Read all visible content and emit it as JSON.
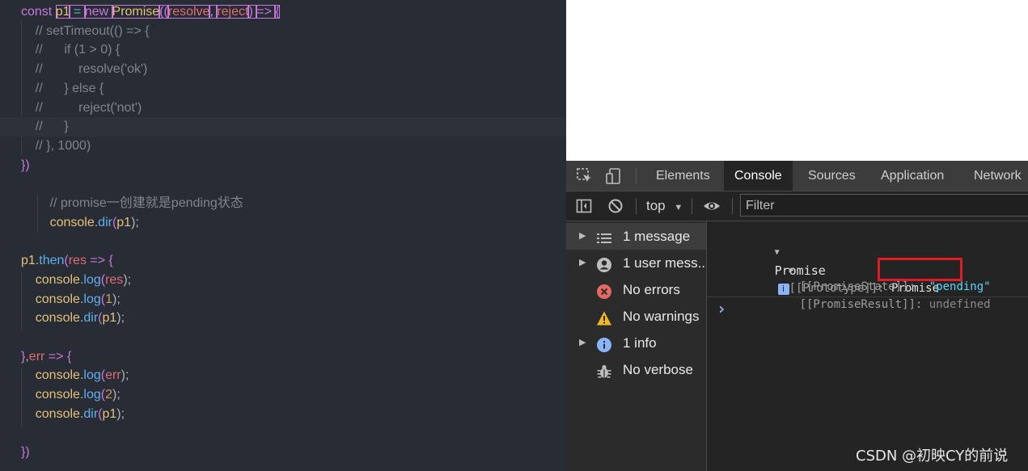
{
  "editor": {
    "lines": [
      {
        "tokens": [
          {
            "t": "const ",
            "c": "kw"
          },
          {
            "t": "p1",
            "c": "var"
          },
          {
            "t": " = ",
            "c": "op"
          },
          {
            "t": "new ",
            "c": "kw"
          },
          {
            "t": "Promise",
            "c": "cls"
          },
          {
            "t": "((",
            "c": "brk"
          },
          {
            "t": "resolve",
            "c": "par"
          },
          {
            "t": ", ",
            "c": "pl"
          },
          {
            "t": "reject",
            "c": "par"
          },
          {
            "t": ") ",
            "c": "brk"
          },
          {
            "t": "=> ",
            "c": "kw"
          },
          {
            "t": "{",
            "c": "brk"
          }
        ]
      },
      {
        "tokens": [
          {
            "t": "    // setTimeout(() => {",
            "c": "com"
          }
        ]
      },
      {
        "tokens": [
          {
            "t": "    //      if (1 > 0) {",
            "c": "com"
          }
        ]
      },
      {
        "tokens": [
          {
            "t": "    //          resolve('ok')",
            "c": "com"
          }
        ]
      },
      {
        "tokens": [
          {
            "t": "    //      } else {",
            "c": "com"
          }
        ]
      },
      {
        "tokens": [
          {
            "t": "    //          reject('not')",
            "c": "com"
          }
        ]
      },
      {
        "tokens": [
          {
            "t": "    //      }",
            "c": "com"
          }
        ]
      },
      {
        "tokens": [
          {
            "t": "    // }, 1000)",
            "c": "com"
          }
        ]
      },
      {
        "tokens": [
          {
            "t": "})",
            "c": "brk"
          }
        ]
      },
      {
        "tokens": []
      },
      {
        "tokens": [
          {
            "t": "        // promise一创建就是pending状态",
            "c": "com"
          }
        ]
      },
      {
        "tokens": [
          {
            "t": "        console",
            "c": "var"
          },
          {
            "t": ".",
            "c": "pl"
          },
          {
            "t": "dir",
            "c": "fn"
          },
          {
            "t": "(",
            "c": "brk"
          },
          {
            "t": "p1",
            "c": "var"
          },
          {
            "t": ");",
            "c": "pl"
          }
        ]
      },
      {
        "tokens": []
      },
      {
        "tokens": [
          {
            "t": "p1",
            "c": "var"
          },
          {
            "t": ".",
            "c": "pl"
          },
          {
            "t": "then",
            "c": "fn"
          },
          {
            "t": "(",
            "c": "brk"
          },
          {
            "t": "res",
            "c": "par"
          },
          {
            "t": " => ",
            "c": "kw"
          },
          {
            "t": "{",
            "c": "brk"
          }
        ]
      },
      {
        "tokens": [
          {
            "t": "    console",
            "c": "var"
          },
          {
            "t": ".",
            "c": "pl"
          },
          {
            "t": "log",
            "c": "fn"
          },
          {
            "t": "(",
            "c": "brk"
          },
          {
            "t": "res",
            "c": "par"
          },
          {
            "t": ");",
            "c": "pl"
          }
        ]
      },
      {
        "tokens": [
          {
            "t": "    console",
            "c": "var"
          },
          {
            "t": ".",
            "c": "pl"
          },
          {
            "t": "log",
            "c": "fn"
          },
          {
            "t": "(",
            "c": "brk"
          },
          {
            "t": "1",
            "c": "num"
          },
          {
            "t": ");",
            "c": "pl"
          }
        ]
      },
      {
        "tokens": [
          {
            "t": "    console",
            "c": "var"
          },
          {
            "t": ".",
            "c": "pl"
          },
          {
            "t": "dir",
            "c": "fn"
          },
          {
            "t": "(",
            "c": "brk"
          },
          {
            "t": "p1",
            "c": "var"
          },
          {
            "t": ");",
            "c": "pl"
          }
        ]
      },
      {
        "tokens": []
      },
      {
        "tokens": [
          {
            "t": "}",
            "c": "brk"
          },
          {
            "t": ",",
            "c": "pl"
          },
          {
            "t": "err",
            "c": "par"
          },
          {
            "t": " => ",
            "c": "kw"
          },
          {
            "t": "{",
            "c": "brk"
          }
        ]
      },
      {
        "tokens": [
          {
            "t": "    console",
            "c": "var"
          },
          {
            "t": ".",
            "c": "pl"
          },
          {
            "t": "log",
            "c": "fn"
          },
          {
            "t": "(",
            "c": "brk"
          },
          {
            "t": "err",
            "c": "par"
          },
          {
            "t": ");",
            "c": "pl"
          }
        ]
      },
      {
        "tokens": [
          {
            "t": "    console",
            "c": "var"
          },
          {
            "t": ".",
            "c": "pl"
          },
          {
            "t": "log",
            "c": "fn"
          },
          {
            "t": "(",
            "c": "brk"
          },
          {
            "t": "2",
            "c": "num"
          },
          {
            "t": ");",
            "c": "pl"
          }
        ]
      },
      {
        "tokens": [
          {
            "t": "    console",
            "c": "var"
          },
          {
            "t": ".",
            "c": "pl"
          },
          {
            "t": "dir",
            "c": "fn"
          },
          {
            "t": "(",
            "c": "brk"
          },
          {
            "t": "p1",
            "c": "var"
          },
          {
            "t": ");",
            "c": "pl"
          }
        ]
      },
      {
        "tokens": []
      },
      {
        "tokens": [
          {
            "t": "})",
            "c": "brk"
          }
        ]
      }
    ]
  },
  "devtools": {
    "tabs": [
      {
        "label": "Elements"
      },
      {
        "label": "Console"
      },
      {
        "label": "Sources"
      },
      {
        "label": "Application"
      },
      {
        "label": "Network"
      }
    ],
    "active_tab": "Console",
    "toolbar": {
      "context": "top",
      "filter_placeholder": "Filter"
    },
    "sidebar": [
      {
        "label": "1 message",
        "icon": "list-icon",
        "expandable": true,
        "selected": true
      },
      {
        "label": "1 user mess...",
        "icon": "user-icon",
        "expandable": true,
        "selected": false
      },
      {
        "label": "No errors",
        "icon": "error-icon",
        "expandable": false,
        "selected": false
      },
      {
        "label": "No warnings",
        "icon": "warning-icon",
        "expandable": false,
        "selected": false
      },
      {
        "label": "1 info",
        "icon": "info-icon",
        "expandable": true,
        "selected": false
      },
      {
        "label": "No verbose",
        "icon": "bug-icon",
        "expandable": false,
        "selected": false
      }
    ],
    "console": {
      "object_label": "Promise",
      "prototype_key": "[[Prototype]]",
      "prototype_value": "Promise",
      "state_key": "[[PromiseState]]",
      "state_value": "\"pending\"",
      "result_key": "[[PromiseResult]]",
      "result_value": "undefined",
      "prompt": "›"
    }
  },
  "watermark": "CSDN @初映CY的前说",
  "colors": {
    "editor_bg": "#282c34",
    "devtools_bg": "#242424",
    "highlight_box": "#e01b24",
    "string": "#5cd5fb"
  }
}
